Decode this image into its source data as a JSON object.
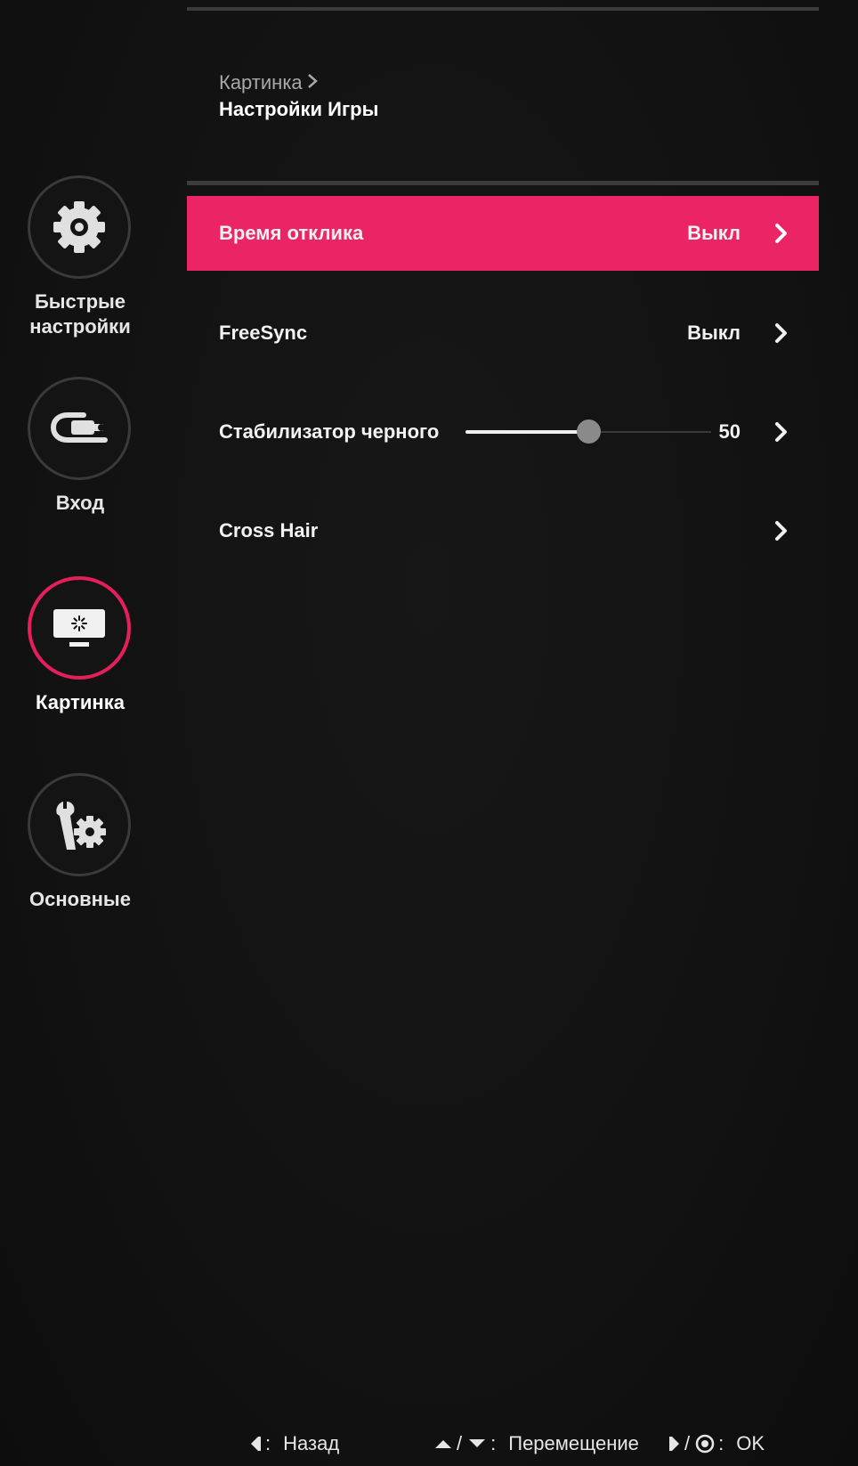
{
  "sidebar": {
    "items": [
      {
        "label": "Быстрые\nнастройки",
        "icon": "gear-icon",
        "active": false
      },
      {
        "label": "Вход",
        "icon": "input-cable-icon",
        "active": false
      },
      {
        "label": "Картинка",
        "icon": "picture-monitor-icon",
        "active": true
      },
      {
        "label": "Основные",
        "icon": "wrench-gear-icon",
        "active": false
      }
    ]
  },
  "header": {
    "breadcrumb": "Картинка",
    "title": "Настройки Игры"
  },
  "menu": {
    "rows": [
      {
        "label": "Время отклика",
        "value": "Выкл",
        "selected": true
      },
      {
        "label": "FreeSync",
        "value": "Выкл",
        "selected": false
      },
      {
        "label": "Стабилизатор черного",
        "value": "50",
        "slider_level": 0.5,
        "selected": false
      },
      {
        "label": "Cross Hair",
        "value": "",
        "selected": false
      }
    ]
  },
  "footer": {
    "back_label": "Назад",
    "move_label": "Перемещение",
    "ok_label": "OK"
  },
  "colors": {
    "accent": "#eb2466",
    "background": "#121212",
    "divider": "#3c3c3c"
  }
}
